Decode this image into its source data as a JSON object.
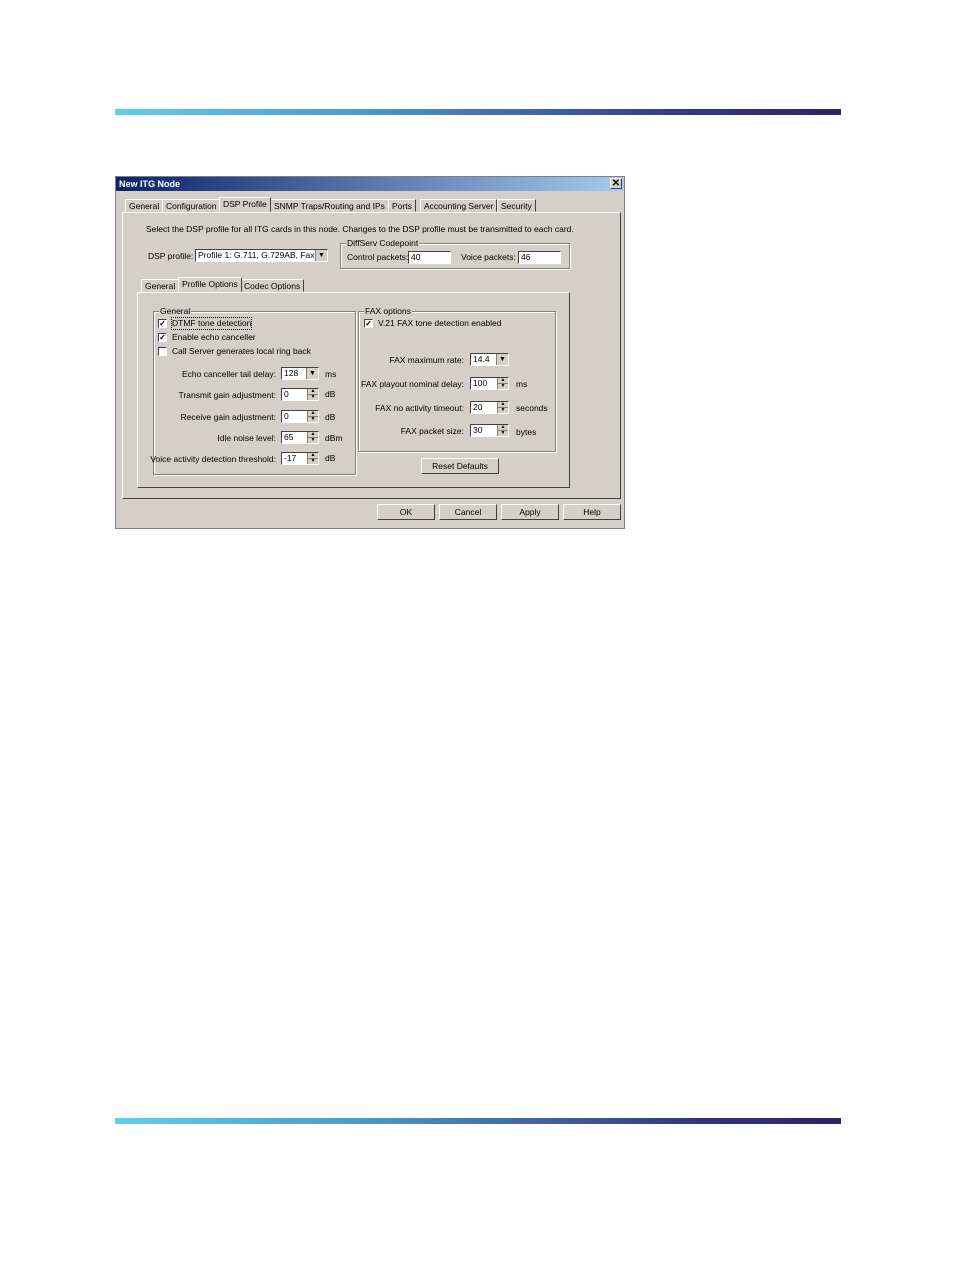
{
  "window": {
    "title": "New ITG Node",
    "close_glyph": "✕"
  },
  "main_tabs": [
    "General",
    "Configuration",
    "DSP Profile",
    "SNMP Traps/Routing and IPs",
    "Ports",
    "Accounting Server",
    "Security"
  ],
  "instruction": "Select the DSP profile for all ITG cards in this node. Changes to the DSP profile must be transmitted to each card.",
  "dsp_profile": {
    "label": "DSP profile:",
    "value": "Profile 1: G.711, G.729AB, Fax"
  },
  "diffserv": {
    "legend": "DiffServ Codepoint",
    "control_label": "Control packets:",
    "control_value": "40",
    "voice_label": "Voice packets:",
    "voice_value": "46"
  },
  "sub_tabs": [
    "General",
    "Profile Options",
    "Codec Options"
  ],
  "general_group": {
    "legend": "General",
    "checkboxes": [
      {
        "label": "DTMF tone detection",
        "checked": true
      },
      {
        "label": "Enable echo canceller",
        "checked": true
      },
      {
        "label": "Call Server generates local ring back",
        "checked": false
      }
    ],
    "echo_tail": {
      "label": "Echo canceller tail delay:",
      "value": "128",
      "unit": "ms"
    },
    "tx_gain": {
      "label": "Transmit gain adjustment:",
      "value": "0",
      "unit": "dB"
    },
    "rx_gain": {
      "label": "Receive gain adjustment:",
      "value": "0",
      "unit": "dB"
    },
    "idle_noise": {
      "label": "Idle noise level:",
      "value": "65",
      "unit": "dBm"
    },
    "vad": {
      "label": "Voice activity detection threshold:",
      "value": "-17",
      "unit": "dB"
    }
  },
  "fax_group": {
    "legend": "FAX options",
    "v21": {
      "label": "V.21 FAX tone detection enabled",
      "checked": true
    },
    "max_rate": {
      "label": "FAX maximum rate:",
      "value": "14.4"
    },
    "playout": {
      "label": "FAX playout nominal delay:",
      "value": "100",
      "unit": "ms"
    },
    "no_activity": {
      "label": "FAX no activity timeout:",
      "value": "20",
      "unit": "seconds"
    },
    "packet_size": {
      "label": "FAX packet size:",
      "value": "30",
      "unit": "bytes"
    }
  },
  "reset_defaults": "Reset Defaults",
  "buttons": {
    "ok": "OK",
    "cancel": "Cancel",
    "apply": "Apply",
    "help": "Help"
  },
  "glyphs": {
    "check": "✓",
    "dropdown": "▼",
    "up": "▲",
    "down": "▼"
  },
  "colors": {
    "titlebar_start": "#0a246a",
    "titlebar_end": "#a6caf0",
    "face": "#d4d0c8"
  }
}
